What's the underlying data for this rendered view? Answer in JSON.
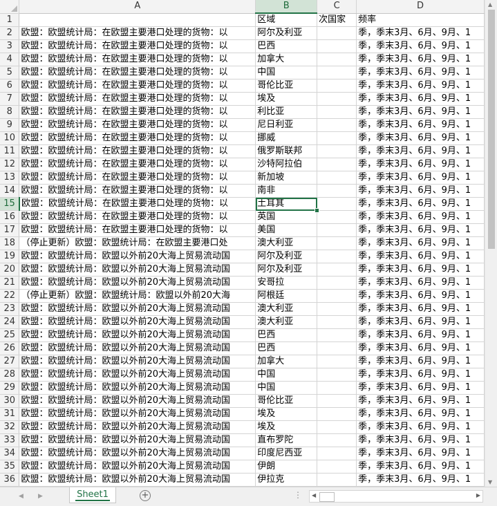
{
  "columns": [
    "A",
    "B",
    "C",
    "D"
  ],
  "active_column": "B",
  "active_row": 15,
  "header_row": {
    "a": "",
    "b": "区域",
    "c": "次国家",
    "d": "频率"
  },
  "rows": [
    {
      "n": "2",
      "a": "欧盟：欧盟统计局：在欧盟主要港口处理的货物：以",
      "b": "阿尔及利亚",
      "c": "",
      "d": "季，季末3月、6月、9月、1"
    },
    {
      "n": "3",
      "a": "欧盟：欧盟统计局：在欧盟主要港口处理的货物：以",
      "b": "巴西",
      "c": "",
      "d": "季，季末3月、6月、9月、1"
    },
    {
      "n": "4",
      "a": "欧盟：欧盟统计局：在欧盟主要港口处理的货物：以",
      "b": "加拿大",
      "c": "",
      "d": "季，季末3月、6月、9月、1"
    },
    {
      "n": "5",
      "a": "欧盟：欧盟统计局：在欧盟主要港口处理的货物：以",
      "b": "中国",
      "c": "",
      "d": "季，季末3月、6月、9月、1"
    },
    {
      "n": "6",
      "a": "欧盟：欧盟统计局：在欧盟主要港口处理的货物：以",
      "b": "哥伦比亚",
      "c": "",
      "d": "季，季末3月、6月、9月、1"
    },
    {
      "n": "7",
      "a": "欧盟：欧盟统计局：在欧盟主要港口处理的货物：以",
      "b": "埃及",
      "c": "",
      "d": "季，季末3月、6月、9月、1"
    },
    {
      "n": "8",
      "a": "欧盟：欧盟统计局：在欧盟主要港口处理的货物：以",
      "b": "利比亚",
      "c": "",
      "d": "季，季末3月、6月、9月、1"
    },
    {
      "n": "9",
      "a": "欧盟：欧盟统计局：在欧盟主要港口处理的货物：以",
      "b": "尼日利亚",
      "c": "",
      "d": "季，季末3月、6月、9月、1"
    },
    {
      "n": "10",
      "a": "欧盟：欧盟统计局：在欧盟主要港口处理的货物：以",
      "b": "挪威",
      "c": "",
      "d": "季，季末3月、6月、9月、1"
    },
    {
      "n": "11",
      "a": "欧盟：欧盟统计局：在欧盟主要港口处理的货物：以",
      "b": "俄罗斯联邦",
      "c": "",
      "d": "季，季末3月、6月、9月、1"
    },
    {
      "n": "12",
      "a": "欧盟：欧盟统计局：在欧盟主要港口处理的货物：以",
      "b": "沙特阿拉伯",
      "c": "",
      "d": "季，季末3月、6月、9月、1"
    },
    {
      "n": "13",
      "a": "欧盟：欧盟统计局：在欧盟主要港口处理的货物：以",
      "b": "新加坡",
      "c": "",
      "d": "季，季末3月、6月、9月、1"
    },
    {
      "n": "14",
      "a": "欧盟：欧盟统计局：在欧盟主要港口处理的货物：以",
      "b": "南非",
      "c": "",
      "d": "季，季末3月、6月、9月、1"
    },
    {
      "n": "15",
      "a": "欧盟：欧盟统计局：在欧盟主要港口处理的货物：以",
      "b": "土耳其",
      "c": "",
      "d": "季，季末3月、6月、9月、1"
    },
    {
      "n": "16",
      "a": "欧盟：欧盟统计局：在欧盟主要港口处理的货物：以",
      "b": "英国",
      "c": "",
      "d": "季，季末3月、6月、9月、1"
    },
    {
      "n": "17",
      "a": "欧盟：欧盟统计局：在欧盟主要港口处理的货物：以",
      "b": "美国",
      "c": "",
      "d": "季，季末3月、6月、9月、1"
    },
    {
      "n": "18",
      "a": "（停止更新）欧盟：欧盟统计局：在欧盟主要港口处",
      "b": "澳大利亚",
      "c": "",
      "d": "季，季末3月、6月、9月、1"
    },
    {
      "n": "19",
      "a": "欧盟：欧盟统计局：欧盟以外前20大海上贸易流动国",
      "b": "阿尔及利亚",
      "c": "",
      "d": "季，季末3月、6月、9月、1"
    },
    {
      "n": "20",
      "a": "欧盟：欧盟统计局：欧盟以外前20大海上贸易流动国",
      "b": "阿尔及利亚",
      "c": "",
      "d": "季，季末3月、6月、9月、1"
    },
    {
      "n": "21",
      "a": "欧盟：欧盟统计局：欧盟以外前20大海上贸易流动国",
      "b": "安哥拉",
      "c": "",
      "d": "季，季末3月、6月、9月、1"
    },
    {
      "n": "22",
      "a": "（停止更新）欧盟：欧盟统计局：欧盟以外前20大海",
      "b": "阿根廷",
      "c": "",
      "d": "季，季末3月、6月、9月、1"
    },
    {
      "n": "23",
      "a": "欧盟：欧盟统计局：欧盟以外前20大海上贸易流动国",
      "b": "澳大利亚",
      "c": "",
      "d": "季，季末3月、6月、9月、1"
    },
    {
      "n": "24",
      "a": "欧盟：欧盟统计局：欧盟以外前20大海上贸易流动国",
      "b": "澳大利亚",
      "c": "",
      "d": "季，季末3月、6月、9月、1"
    },
    {
      "n": "25",
      "a": "欧盟：欧盟统计局：欧盟以外前20大海上贸易流动国",
      "b": "巴西",
      "c": "",
      "d": "季，季末3月、6月、9月、1"
    },
    {
      "n": "26",
      "a": "欧盟：欧盟统计局：欧盟以外前20大海上贸易流动国",
      "b": "巴西",
      "c": "",
      "d": "季，季末3月、6月、9月、1"
    },
    {
      "n": "27",
      "a": "欧盟：欧盟统计局：欧盟以外前20大海上贸易流动国",
      "b": "加拿大",
      "c": "",
      "d": "季，季末3月、6月、9月、1"
    },
    {
      "n": "28",
      "a": "欧盟：欧盟统计局：欧盟以外前20大海上贸易流动国",
      "b": "中国",
      "c": "",
      "d": "季，季末3月、6月、9月、1"
    },
    {
      "n": "29",
      "a": "欧盟：欧盟统计局：欧盟以外前20大海上贸易流动国",
      "b": "中国",
      "c": "",
      "d": "季，季末3月、6月、9月、1"
    },
    {
      "n": "30",
      "a": "欧盟：欧盟统计局：欧盟以外前20大海上贸易流动国",
      "b": "哥伦比亚",
      "c": "",
      "d": "季，季末3月、6月、9月、1"
    },
    {
      "n": "31",
      "a": "欧盟：欧盟统计局：欧盟以外前20大海上贸易流动国",
      "b": "埃及",
      "c": "",
      "d": "季，季末3月、6月、9月、1"
    },
    {
      "n": "32",
      "a": "欧盟：欧盟统计局：欧盟以外前20大海上贸易流动国",
      "b": "埃及",
      "c": "",
      "d": "季，季末3月、6月、9月、1"
    },
    {
      "n": "33",
      "a": "欧盟：欧盟统计局：欧盟以外前20大海上贸易流动国",
      "b": "直布罗陀",
      "c": "",
      "d": "季，季末3月、6月、9月、1"
    },
    {
      "n": "34",
      "a": "欧盟：欧盟统计局：欧盟以外前20大海上贸易流动国",
      "b": "印度尼西亚",
      "c": "",
      "d": "季，季末3月、6月、9月、1"
    },
    {
      "n": "35",
      "a": "欧盟：欧盟统计局：欧盟以外前20大海上贸易流动国",
      "b": "伊朗",
      "c": "",
      "d": "季，季末3月、6月、9月、1"
    },
    {
      "n": "36",
      "a": "欧盟：欧盟统计局：欧盟以外前20大海上贸易流动国",
      "b": "伊拉克",
      "c": "",
      "d": "季，季末3月、6月、9月、1"
    }
  ],
  "sheet_tab": "Sheet1",
  "add_sheet_symbol": "+",
  "more_symbol": "⋮",
  "accent_color": "#217346"
}
